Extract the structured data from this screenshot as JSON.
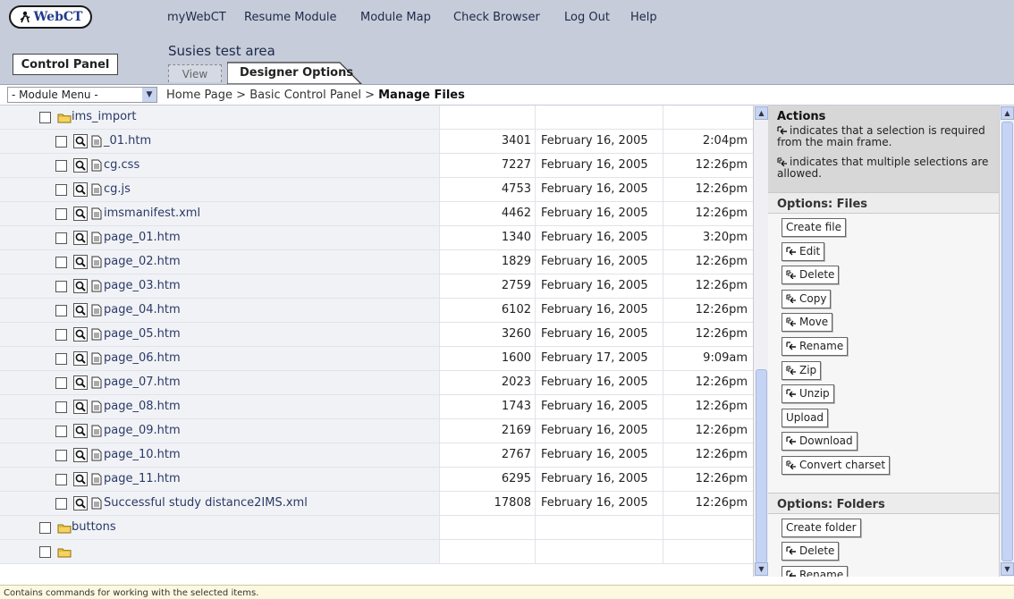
{
  "header": {
    "logo_text": "WebCT",
    "nav": [
      "myWebCT",
      "Resume Module",
      "Module Map",
      "Check Browser",
      "Log Out",
      "Help"
    ]
  },
  "subheader": {
    "control_panel_label": "Control Panel",
    "course_title": "Susies test area",
    "tabs": [
      {
        "label": "View",
        "active": false
      },
      {
        "label": "Designer Options",
        "active": true
      }
    ]
  },
  "breadcrumb_bar": {
    "module_menu_value": "- Module Menu -",
    "crumbs": [
      "Home Page",
      "Basic Control Panel"
    ],
    "current": "Manage Files",
    "separator": ">"
  },
  "files": [
    {
      "name": "ims_import",
      "type": "folder",
      "size": "",
      "date": "",
      "time": "",
      "indent": 1
    },
    {
      "name": "_01.htm",
      "type": "file",
      "size": "3401",
      "date": "February 16, 2005",
      "time": "2:04pm",
      "indent": 2
    },
    {
      "name": "cg.css",
      "type": "file",
      "size": "7227",
      "date": "February 16, 2005",
      "time": "12:26pm",
      "indent": 2
    },
    {
      "name": "cg.js",
      "type": "file",
      "size": "4753",
      "date": "February 16, 2005",
      "time": "12:26pm",
      "indent": 2
    },
    {
      "name": "imsmanifest.xml",
      "type": "file",
      "size": "4462",
      "date": "February 16, 2005",
      "time": "12:26pm",
      "indent": 2
    },
    {
      "name": "page_01.htm",
      "type": "file",
      "size": "1340",
      "date": "February 16, 2005",
      "time": "3:20pm",
      "indent": 2
    },
    {
      "name": "page_02.htm",
      "type": "file",
      "size": "1829",
      "date": "February 16, 2005",
      "time": "12:26pm",
      "indent": 2
    },
    {
      "name": "page_03.htm",
      "type": "file",
      "size": "2759",
      "date": "February 16, 2005",
      "time": "12:26pm",
      "indent": 2
    },
    {
      "name": "page_04.htm",
      "type": "file",
      "size": "6102",
      "date": "February 16, 2005",
      "time": "12:26pm",
      "indent": 2
    },
    {
      "name": "page_05.htm",
      "type": "file",
      "size": "3260",
      "date": "February 16, 2005",
      "time": "12:26pm",
      "indent": 2
    },
    {
      "name": "page_06.htm",
      "type": "file",
      "size": "1600",
      "date": "February 17, 2005",
      "time": "9:09am",
      "indent": 2
    },
    {
      "name": "page_07.htm",
      "type": "file",
      "size": "2023",
      "date": "February 16, 2005",
      "time": "12:26pm",
      "indent": 2
    },
    {
      "name": "page_08.htm",
      "type": "file",
      "size": "1743",
      "date": "February 16, 2005",
      "time": "12:26pm",
      "indent": 2
    },
    {
      "name": "page_09.htm",
      "type": "file",
      "size": "2169",
      "date": "February 16, 2005",
      "time": "12:26pm",
      "indent": 2
    },
    {
      "name": "page_10.htm",
      "type": "file",
      "size": "2767",
      "date": "February 16, 2005",
      "time": "12:26pm",
      "indent": 2
    },
    {
      "name": "page_11.htm",
      "type": "file",
      "size": "6295",
      "date": "February 16, 2005",
      "time": "12:26pm",
      "indent": 2
    },
    {
      "name": "Successful study distance2IMS.xml",
      "type": "file",
      "size": "17808",
      "date": "February 16, 2005",
      "time": "12:26pm",
      "indent": 2
    },
    {
      "name": "buttons",
      "type": "folder",
      "size": "",
      "date": "",
      "time": "",
      "indent": 1
    },
    {
      "name": "",
      "type": "folder",
      "size": "",
      "date": "",
      "time": "",
      "indent": 1
    }
  ],
  "actions": {
    "title": "Actions",
    "note_single": "indicates that a selection is required from the main frame.",
    "note_multi": "indicates that multiple selections are allowed.",
    "sections": [
      {
        "title": "Options: Files",
        "buttons": [
          {
            "label": "Create file",
            "marker": "none"
          },
          {
            "label": "Edit",
            "marker": "single"
          },
          {
            "label": "Delete",
            "marker": "multi"
          },
          {
            "label": "Copy",
            "marker": "multi"
          },
          {
            "label": "Move",
            "marker": "multi"
          },
          {
            "label": "Rename",
            "marker": "single"
          },
          {
            "label": "Zip",
            "marker": "multi"
          },
          {
            "label": "Unzip",
            "marker": "single"
          },
          {
            "label": "Upload",
            "marker": "none"
          },
          {
            "label": "Download",
            "marker": "single"
          },
          {
            "label": "Convert charset",
            "marker": "multi"
          }
        ]
      },
      {
        "title": "Options: Folders",
        "buttons": [
          {
            "label": "Create folder",
            "marker": "none"
          },
          {
            "label": "Delete",
            "marker": "single"
          },
          {
            "label": "Rename",
            "marker": "single"
          }
        ]
      }
    ]
  },
  "status_text": "Contains commands for working with the selected items.",
  "colors": {
    "header_bg": "#c6ccd9",
    "name_column_bg": "#f1f2f6",
    "scroll_thumb": "#c5d4f4"
  }
}
